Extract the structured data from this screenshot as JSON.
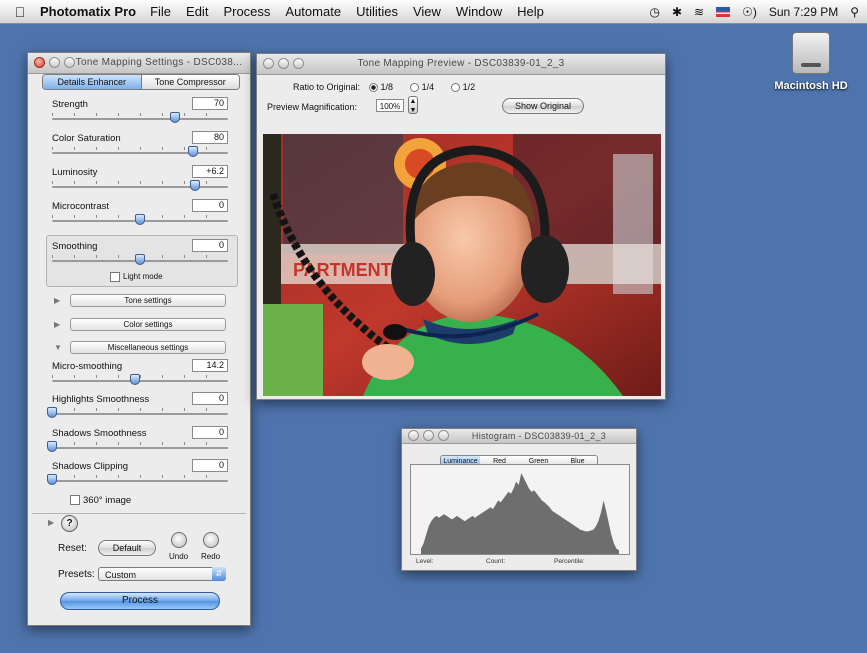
{
  "menubar": {
    "app_name": "Photomatix Pro",
    "menus": [
      "File",
      "Edit",
      "Process",
      "Automate",
      "Utilities",
      "View",
      "Window",
      "Help"
    ],
    "clock": "Sun 7:29 PM"
  },
  "desktop": {
    "disk_label": "Macintosh HD"
  },
  "settings": {
    "title": "Tone Mapping Settings - DSC038...",
    "tabs": [
      "Details Enhancer",
      "Tone Compressor"
    ],
    "strength": {
      "label": "Strength",
      "value": "70",
      "level": 0.7
    },
    "saturation": {
      "label": "Color Saturation",
      "value": "80",
      "level": 0.8
    },
    "luminosity": {
      "label": "Luminosity",
      "value": "+6.2",
      "level": 0.81
    },
    "microcontrast": {
      "label": "Microcontrast",
      "value": "0",
      "level": 0.5
    },
    "smoothing": {
      "label": "Smoothing",
      "value": "0",
      "level": 0.5
    },
    "light_mode": "Light mode",
    "tone_settings": "Tone settings",
    "color_settings": "Color settings",
    "misc_settings": "Miscellaneous settings",
    "micro_smoothing": {
      "label": "Micro-smoothing",
      "value": "14.2",
      "level": 0.47
    },
    "highlights_smoothness": {
      "label": "Highlights Smoothness",
      "value": "0",
      "level": 0.0
    },
    "shadows_smoothness": {
      "label": "Shadows Smoothness",
      "value": "0",
      "level": 0.0
    },
    "shadows_clipping": {
      "label": "Shadows Clipping",
      "value": "0",
      "level": 0.0
    },
    "image_360": "360° image",
    "help": "?",
    "reset_label": "Reset:",
    "default_button": "Default",
    "undo": "Undo",
    "redo": "Redo",
    "presets_label": "Presets:",
    "preset_value": "Custom",
    "process_button": "Process"
  },
  "preview": {
    "title": "Tone Mapping Preview - DSC03839-01_2_3",
    "ratio_label": "Ratio to Original:",
    "ratios": [
      "1/8",
      "1/4",
      "1/2"
    ],
    "magnification_label": "Preview Magnification:",
    "magnification_value": "100%",
    "show_original": "Show Original"
  },
  "histogram": {
    "title": "Histogram - DSC03839-01_2_3",
    "tabs": [
      "Luminance",
      "Red",
      "Green",
      "Blue"
    ],
    "level_label": "Level:",
    "count_label": "Count:",
    "percentile_label": "Percentile:",
    "bins": [
      4,
      10,
      20,
      30,
      36,
      40,
      42,
      40,
      42,
      44,
      42,
      40,
      38,
      40,
      42,
      40,
      38,
      36,
      38,
      40,
      42,
      40,
      42,
      44,
      46,
      48,
      50,
      52,
      50,
      55,
      60,
      58,
      62,
      66,
      70,
      68,
      74,
      82,
      78,
      92,
      86,
      80,
      74,
      70,
      72,
      68,
      64,
      60,
      58,
      55,
      52,
      48,
      46,
      44,
      42,
      40,
      38,
      36,
      34,
      32,
      30,
      28,
      26,
      25,
      24,
      24,
      25,
      26,
      30,
      36,
      46,
      60,
      48,
      34,
      20,
      10,
      4,
      2
    ]
  }
}
